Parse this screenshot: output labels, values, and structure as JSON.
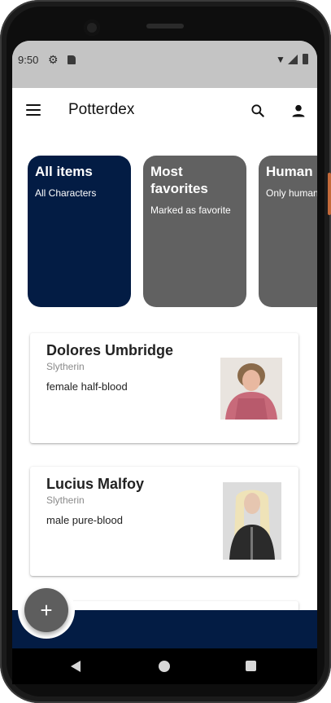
{
  "status_bar": {
    "time": "9:50",
    "icons": [
      "gear-icon",
      "sd-card-icon",
      "wifi-icon",
      "signal-icon",
      "battery-icon"
    ]
  },
  "app_bar": {
    "title": "Potterdex",
    "icons": [
      "menu-icon",
      "search-icon",
      "person-icon"
    ]
  },
  "categories": [
    {
      "title": "All items",
      "subtitle": "All Characters",
      "color": "#031c44",
      "selected": true
    },
    {
      "title": "Most favorites",
      "subtitle": "Marked as favorite",
      "color": "#616161",
      "selected": false
    },
    {
      "title": "Human",
      "subtitle": "Only human",
      "color": "#616161",
      "selected": false
    }
  ],
  "characters": [
    {
      "name": "Dolores Umbridge",
      "house": "Slytherin",
      "description": "female half-blood"
    },
    {
      "name": "Lucius Malfoy",
      "house": "Slytherin",
      "description": "male pure-blood"
    }
  ],
  "fab": {
    "label": "+"
  },
  "colors": {
    "primary": "#031c44",
    "secondary": "#616161",
    "fab": "#5e5e5e"
  }
}
